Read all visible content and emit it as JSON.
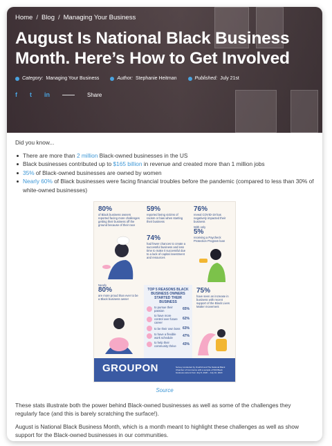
{
  "breadcrumb": [
    "Home",
    "Blog",
    "Managing Your Business"
  ],
  "title": "August Is National Black Business Month. Here’s How to Get Involved",
  "meta": {
    "category_label": "Category:",
    "category": "Managing Your Business",
    "author_label": "Author:",
    "author": "Stephanie Heitman",
    "published_label": "Published:",
    "published": "July 21st"
  },
  "share": {
    "facebook": "f",
    "twitter": "t",
    "linkedin": "in",
    "label": "Share"
  },
  "intro": "Did you know...",
  "bullets": [
    {
      "pre": "There are more than ",
      "link": "2 million",
      "post": " Black-owned businesses in the US"
    },
    {
      "pre": "Black businesses contributed up to ",
      "link": "$165 billion",
      "post": " in revenue and created more than 1 million jobs"
    },
    {
      "pre": "",
      "link": "35%",
      "post": " of Black-owned businesses are owned by women"
    },
    {
      "pre": "",
      "link": "Nearly 60%",
      "post": " of Black businesses were facing financial troubles before the pandemic (compared to less than 30% of white-owned businesses)"
    }
  ],
  "infographic": {
    "stat1_big": "80%",
    "stat1_text": "of Black business owners reported facing more challenges getting their business off the ground because of their race",
    "stat2_big": "59%",
    "stat2_text": "reported being victims of racism or bias when starting their business",
    "stat3_big": "74%",
    "stat3_text": "had fewer chances to create a successful business and less time to make it successful due to a lack of capital investment and resources",
    "stat4_big": "76%",
    "stat4_text": "reveal COVID-19 has negatively impacted their business",
    "stat5_pre": "With only",
    "stat5_big": "5%",
    "stat5_text": "receiving a Paycheck Protection Program loan",
    "stat6_pre": "Nearly",
    "stat6_big": "80%",
    "stat6_text": "are more proud than ever to be a Black business owner",
    "reasons_title": "TOP 5 REASONS BLACK BUSINESS OWNERS STARTED THEIR BUSINESS",
    "reasons": [
      {
        "label": "to pursue their passion",
        "pct": "65%"
      },
      {
        "label": "to have more control over future career",
        "pct": "62%"
      },
      {
        "label": "to be their own boss",
        "pct": "63%"
      },
      {
        "label": "to have a flexible work schedule",
        "pct": "47%"
      },
      {
        "label": "to help their community thrive",
        "pct": "43%"
      }
    ],
    "stat7_big": "75%",
    "stat7_text": "have seen an increase in business with recent support of the Black Lives Matter movement",
    "brand": "GROUPON",
    "footnote": "Survey conducted by OnePoll and The National Black Chamber of Commerce with a sample of 500 Black business owners from July 8, 2020 – July 10, 2020"
  },
  "source_label": "Source",
  "para1": "These stats illustrate both the power behind Black-owned businesses as well as some of the challenges they regularly face (and this is barely scratching the surface!).",
  "para2": "August is National Black Business Month, which is a month meant to highlight these challenges as well as show support for the Black-owned businesses in our communities.",
  "colors": {
    "link": "#3d97d6",
    "brand": "#3a5aa3",
    "accent_pink": "#f6a9c6"
  }
}
